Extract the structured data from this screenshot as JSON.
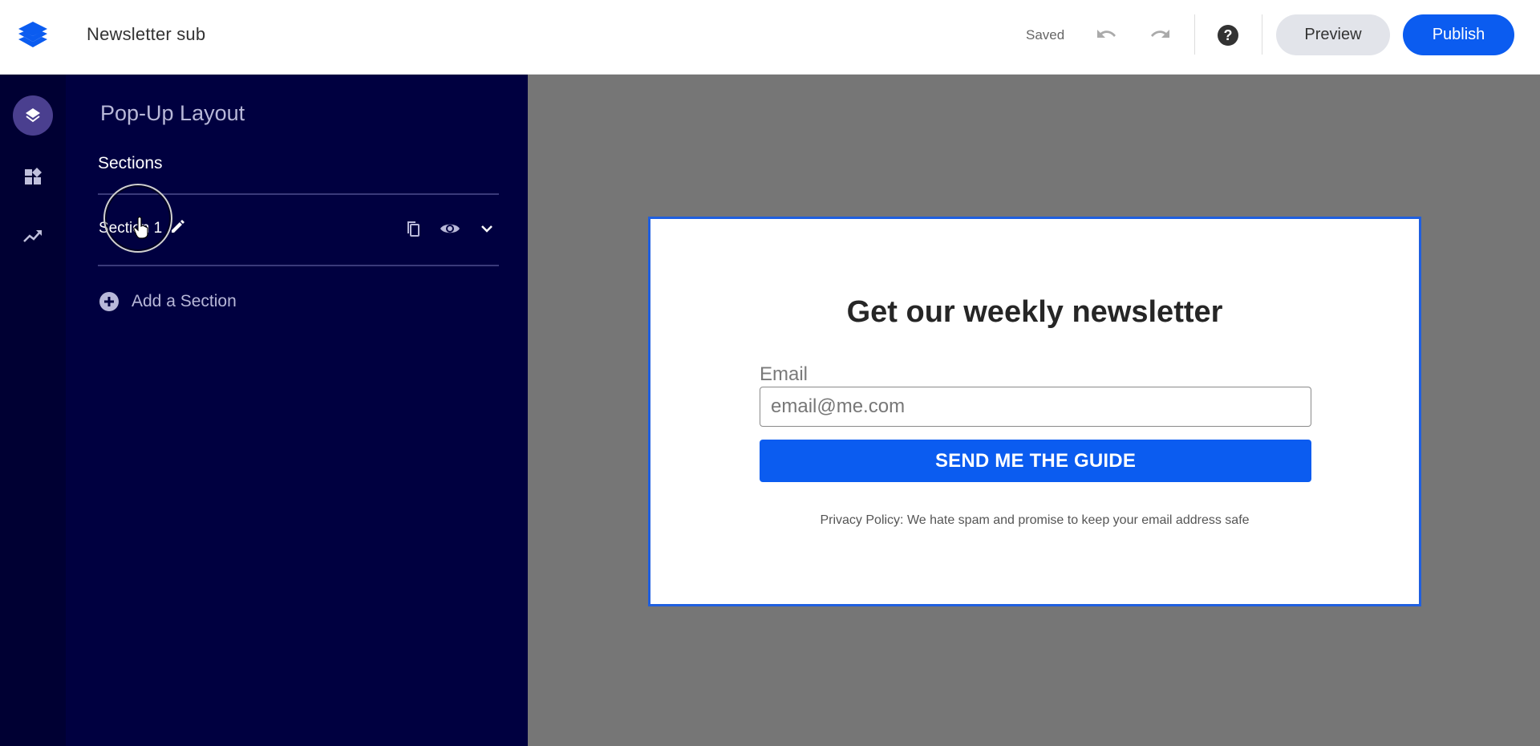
{
  "app": {
    "document_title": "Newsletter sub",
    "logo_icon": "stacked-layers-icon",
    "brand_color": "#0b5cf0"
  },
  "toolbar": {
    "status": "Saved",
    "undo_icon": "undo-icon",
    "redo_icon": "redo-icon",
    "help_icon": "help-icon",
    "preview_label": "Preview",
    "publish_label": "Publish"
  },
  "rail": {
    "items": [
      {
        "name": "layers",
        "icon": "layers-icon",
        "active": true
      },
      {
        "name": "widgets",
        "icon": "widgets-icon",
        "active": false
      },
      {
        "name": "analytics",
        "icon": "trending-up-icon",
        "active": false
      }
    ]
  },
  "panel": {
    "title": "Pop-Up Layout",
    "sections_label": "Sections",
    "sections": [
      {
        "name": "Section 1",
        "actions": [
          "edit-icon",
          "copy-icon",
          "eye-icon",
          "chevron-down-icon"
        ]
      }
    ],
    "add_section_label": "Add a Section"
  },
  "popup": {
    "heading": "Get our weekly newsletter",
    "email_label": "Email",
    "email_placeholder": "email@me.com",
    "email_value": "",
    "cta_label": "SEND ME THE GUIDE",
    "privacy_text": "Privacy Policy: We hate spam and promise to keep your email address safe",
    "border_color": "#1f5fe0",
    "button_color": "#0b5cf0"
  },
  "colors": {
    "rail_bg": "#000033",
    "panel_bg": "#000040",
    "canvas_bg": "#767676"
  }
}
